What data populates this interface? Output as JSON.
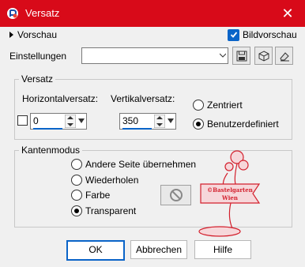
{
  "window": {
    "title": "Versatz"
  },
  "preview": {
    "label": "Vorschau",
    "bildvorschau_label": "Bildvorschau",
    "bildvorschau_checked": true
  },
  "einstellungen": {
    "label": "Einstellungen",
    "value": ""
  },
  "versatz": {
    "group_label": "Versatz",
    "horizontal_label": "Horizontalversatz:",
    "horizontal_value": "0",
    "vertikal_label": "Vertikalversatz:",
    "vertikal_value": "350",
    "zentriert_label": "Zentriert",
    "benutzerdefiniert_label": "Benutzerdefiniert",
    "selected": "Benutzerdefiniert"
  },
  "kantenmodus": {
    "group_label": "Kantenmodus",
    "options": [
      "Andere Seite übernehmen",
      "Wiederholen",
      "Farbe",
      "Transparent"
    ],
    "selected": "Transparent"
  },
  "buttons": {
    "ok": "OK",
    "abbrechen": "Abbrechen",
    "hilfe": "Hilfe"
  },
  "watermark": {
    "line1": "©Bastelgarten",
    "line2": "Wien"
  },
  "colors": {
    "titlebar": "#d80a19",
    "accent": "#0a64c8",
    "watermark": "#d31f2c"
  }
}
